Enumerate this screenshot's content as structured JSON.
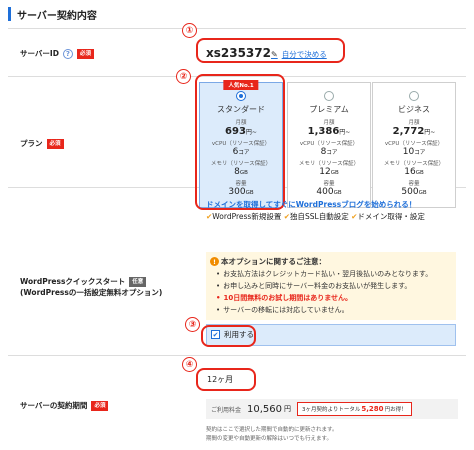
{
  "section": {
    "title": "サーバー契約内容"
  },
  "labels": {
    "server_id": "サーバーID",
    "plan": "プラン",
    "wp_quick_line1": "WordPressクイックスタート",
    "wp_quick_line2": "(WordPressの一括設定無料オプション)",
    "contract_period": "サーバーの契約期間",
    "required": "必須",
    "optional": "任意",
    "help": "?"
  },
  "badges": {
    "n1": "①",
    "n2": "②",
    "n3": "③",
    "n4": "④"
  },
  "server_id": {
    "value": "xs235372",
    "link": "自分で決める"
  },
  "plans": [
    {
      "name": "スタンダード",
      "price_label": "月額",
      "price": "693",
      "price_unit": "円~",
      "vcpu_label": "vCPU（リソース保証）",
      "vcpu": "6",
      "vcpu_unit": "コア",
      "mem_label": "メモリ（リソース保証）",
      "mem": "8",
      "mem_unit": "GB",
      "storage_label": "容量",
      "storage": "300",
      "storage_unit": "GB",
      "popular": "人気No.1",
      "selected": true
    },
    {
      "name": "プレミアム",
      "price_label": "月額",
      "price": "1,386",
      "price_unit": "円~",
      "vcpu_label": "vCPU（リソース保証）",
      "vcpu": "8",
      "vcpu_unit": "コア",
      "mem_label": "メモリ（リソース保証）",
      "mem": "12",
      "mem_unit": "GB",
      "storage_label": "容量",
      "storage": "400",
      "storage_unit": "GB",
      "selected": false
    },
    {
      "name": "ビジネス",
      "price_label": "月額",
      "price": "2,772",
      "price_unit": "円~",
      "vcpu_label": "vCPU（リソース保証）",
      "vcpu": "10",
      "vcpu_unit": "コア",
      "mem_label": "メモリ（リソース保証）",
      "mem": "16",
      "mem_unit": "GB",
      "storage_label": "容量",
      "storage": "500",
      "storage_unit": "GB",
      "selected": false
    }
  ],
  "wp": {
    "headline": "ドメインを取得してすぐにWordPressブログを始められる！",
    "check": "✔",
    "feature1": "WordPress新規設置",
    "feature2": "独自SSL自動設定",
    "feature3": "ドメイン取得・設定"
  },
  "notice": {
    "icon": "!",
    "title": "本オプションに関するご注意：",
    "items": [
      "お支払方法はクレジットカード払い・翌月後払いのみとなります。",
      "お申し込みと同時にサーバー料金のお支払いが発生します。",
      "10日間無料のお試し期間はありません。",
      "サーバーの移転には対応していません。"
    ]
  },
  "use_option": {
    "label": "利用する",
    "checked": true,
    "checkmark": "✔"
  },
  "period": {
    "selected": "12ヶ月"
  },
  "fee": {
    "label": "ご利用料金",
    "amount": "10,560",
    "yen": "円",
    "promo_prefix": "3ヶ月契約よりトータル",
    "promo_amount": "5,280",
    "promo_suffix": "円お得！"
  },
  "notes": {
    "line1": "契約はここで選択した期間で自動的に更新されます。",
    "line2": "期間の変更や自動更新の解除はいつでも行えます。"
  },
  "colors": {
    "accent": "#1e6fd9",
    "required": "#e8261b",
    "selected_bg": "#dcebfb",
    "notice_bg": "#fff7e0",
    "highlight": "#e8261b"
  }
}
